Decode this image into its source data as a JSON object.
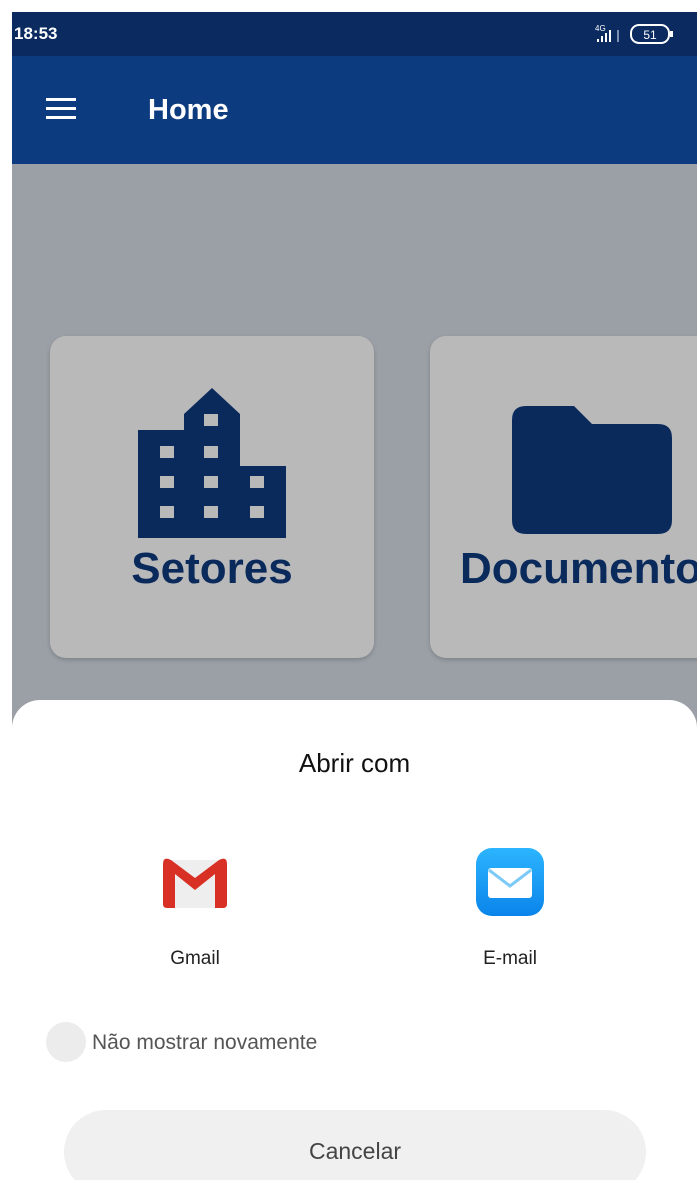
{
  "status_bar": {
    "time": "18:53",
    "network": "4G",
    "battery": "51"
  },
  "app_bar": {
    "title": "Home",
    "menu_icon": "hamburger-menu-icon",
    "background": "#0d3b7f"
  },
  "cards": [
    {
      "label": "Setores",
      "icon": "building-icon"
    },
    {
      "label": "Documento",
      "icon": "folder-icon"
    }
  ],
  "dialog": {
    "title": "Abrir com",
    "apps": [
      {
        "label": "Gmail",
        "icon": "gmail-icon"
      },
      {
        "label": "E-mail",
        "icon": "email-icon"
      }
    ],
    "dont_show_again": "Não mostrar novamente",
    "dont_show_again_checked": false,
    "cancel": "Cancelar"
  },
  "colors": {
    "status_bar": "#0a2a60",
    "primary_dark": "#0b2a5c",
    "scrim": "#9aa0a6",
    "card": "#b9b9b9",
    "gmail_red": "#d93025",
    "email_blue": "#1aa3f5"
  }
}
